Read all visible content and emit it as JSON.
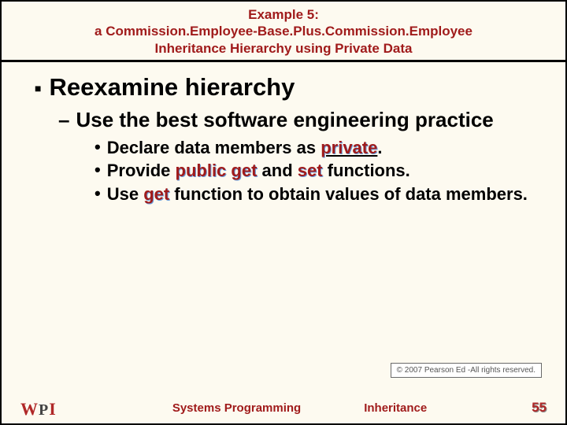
{
  "title": {
    "line1": "Example 5:",
    "line2": "a Commission.Employee-Base.Plus.Commission.Employee",
    "line3": "Inheritance Hierarchy using Private Data"
  },
  "content": {
    "lvl1": "Reexamine hierarchy",
    "lvl2": "Use the best software engineering practice",
    "b1_pre": "Declare data members as ",
    "kw_private": "private",
    "b1_post": ".",
    "b2_pre": "Provide ",
    "kw_public": "public",
    "b2_mid1": " ",
    "kw_get": "get",
    "b2_mid2": " and ",
    "kw_set": "set",
    "b2_post": " functions.",
    "b3_pre": "Use ",
    "kw_get2": "get",
    "b3_post": " function to obtain values of data members."
  },
  "copyright": "© 2007 Pearson Ed -All rights reserved.",
  "footer": {
    "left": "Systems Programming",
    "right": "Inheritance",
    "page": "55"
  },
  "logo": {
    "w": "W",
    "p": "P",
    "i": "I"
  }
}
